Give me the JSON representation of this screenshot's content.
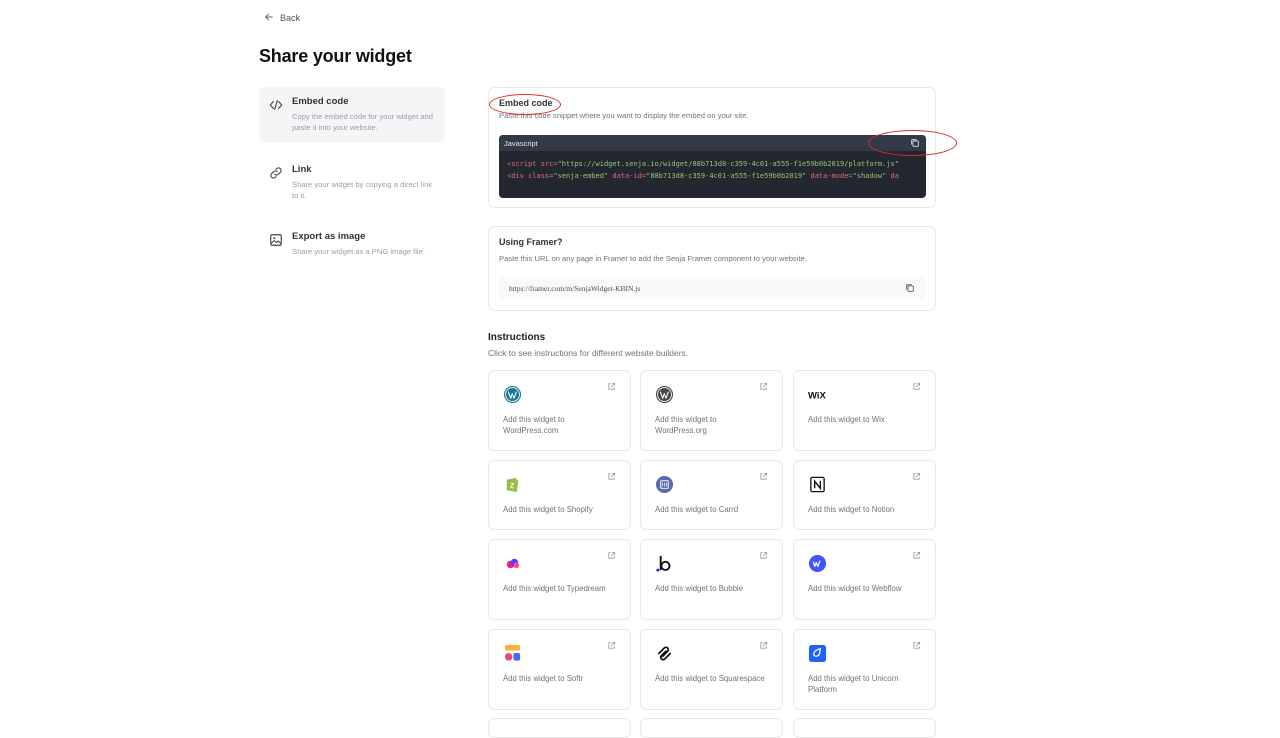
{
  "nav": {
    "back_label": "Back"
  },
  "page": {
    "title": "Share your widget"
  },
  "sidebar": {
    "items": [
      {
        "title": "Embed code",
        "desc": "Copy the embed code for your widget and paste it into your website.",
        "icon": "code-icon"
      },
      {
        "title": "Link",
        "desc": "Share your widget by copying a direct link to it.",
        "icon": "link-icon"
      },
      {
        "title": "Export as image",
        "desc": "Share your widget as a PNG image file.",
        "icon": "image-icon"
      }
    ]
  },
  "embed": {
    "title": "Embed code",
    "desc": "Paste this code snippet where you want to display the embed on your site.",
    "language": "Javascript",
    "line1": {
      "tag_open": "<script",
      "attr": " src=",
      "value": "\"https://widget.senja.io/widget/88b713d8-c359-4c01-a555-f1e59b0b2019/platform.js\""
    },
    "line2": {
      "tag_open": "<div",
      "attr1": " class=",
      "value1": "\"senja-embed\"",
      "attr2": " data-id=",
      "value2": "\"88b713d8-c359-4c01-a555-f1e59b0b2019\"",
      "attr3": " data-mode=",
      "value3": "\"shadow\"",
      "attr4": " da"
    }
  },
  "framer": {
    "title": "Using Framer?",
    "desc": "Paste this URL on any page in Framer to add the Senja Framer component to your website.",
    "url": "https://framer.com/m/SenjaWidget-KBIN.js"
  },
  "instructions": {
    "title": "Instructions",
    "desc": "Click to see instructions for different website builders.",
    "tiles": [
      {
        "label": "Add this widget to WordPress.com",
        "icon": "wordpress-com-icon"
      },
      {
        "label": "Add this widget to WordPress.org",
        "icon": "wordpress-org-icon"
      },
      {
        "label": "Add this widget to Wix",
        "icon": "wix-icon",
        "logo_text": "WiX"
      },
      {
        "label": "Add this widget to Shopify",
        "icon": "shopify-icon"
      },
      {
        "label": "Add this widget to Carrd",
        "icon": "carrd-icon"
      },
      {
        "label": "Add this widget to Notion",
        "icon": "notion-icon"
      },
      {
        "label": "Add this widget to Typedream",
        "icon": "typedream-icon"
      },
      {
        "label": "Add this widget to Bubble",
        "icon": "bubble-icon"
      },
      {
        "label": "Add this widget to Webflow",
        "icon": "webflow-icon"
      },
      {
        "label": "Add this widget to Softr",
        "icon": "softr-icon"
      },
      {
        "label": "Add this widget to Squarespace",
        "icon": "squarespace-icon"
      },
      {
        "label": "Add this widget to Unicorn Platform",
        "icon": "unicorn-platform-icon"
      }
    ]
  },
  "colors": {
    "annotation": "#d62b2b",
    "code_bg": "#23272f",
    "accent_wix": "#111111"
  }
}
